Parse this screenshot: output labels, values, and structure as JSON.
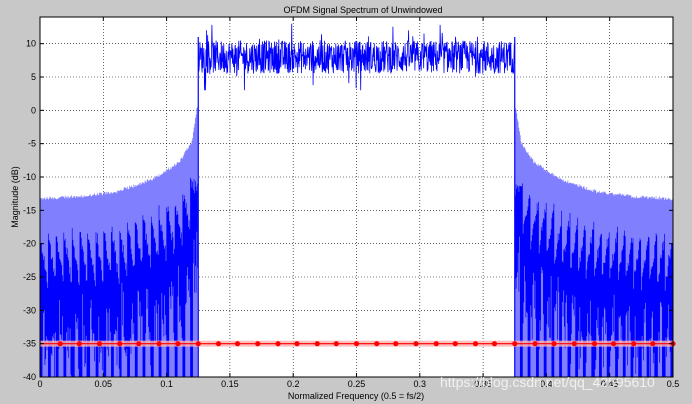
{
  "chart_data": {
    "type": "line",
    "title": "OFDM Signal Spectrum of Unwindowed",
    "xlabel": "Normalized Frequency (0.5 = fs/2)",
    "ylabel": "Magnitude (dB)",
    "xlim": [
      0,
      0.5
    ],
    "ylim": [
      -40,
      14
    ],
    "xticks": [
      0,
      0.05,
      0.1,
      0.15,
      0.2,
      0.25,
      0.3,
      0.35,
      0.4,
      0.45,
      0.5
    ],
    "xtick_labels": [
      "0",
      "0.05",
      "0.1",
      "0.15",
      "0.2",
      "0.25",
      "0.3",
      "0.35",
      "0.4",
      "0.45",
      "0.5"
    ],
    "yticks": [
      -40,
      -35,
      -30,
      -25,
      -20,
      -15,
      -10,
      -5,
      0,
      5,
      10
    ],
    "ytick_labels": [
      "-40",
      "-35",
      "-30",
      "-25",
      "-20",
      "-15",
      "-10",
      "-5",
      "0",
      "5",
      "10"
    ],
    "grid": true,
    "colors": {
      "spectrum": "#0000ff",
      "marker_line": "#ff0000",
      "axes_bg": "#ffffff",
      "figure_bg": "#c8c8c8"
    },
    "series": [
      {
        "style": "noisy-spectrum",
        "passband": {
          "x": [
            0.125,
            0.375
          ],
          "mean_db": 8,
          "min_db": 3,
          "max_db": 13
        },
        "sidelobe_envelope": {
          "x": [
            0,
            0.03,
            0.06,
            0.09,
            0.11,
            0.12,
            0.124
          ],
          "y": [
            -13.5,
            -13.2,
            -12.5,
            -10.5,
            -8,
            -5,
            0
          ]
        },
        "sidelobe_floor_db": -40
      },
      {
        "style": "marker-line",
        "y": -35,
        "marker_x": [
          0.016,
          0.031,
          0.047,
          0.063,
          0.078,
          0.094,
          0.109,
          0.125,
          0.141,
          0.156,
          0.172,
          0.188,
          0.203,
          0.219,
          0.234,
          0.25,
          0.266,
          0.281,
          0.297,
          0.313,
          0.328,
          0.344,
          0.359,
          0.375,
          0.391,
          0.406,
          0.422,
          0.438,
          0.453,
          0.469,
          0.484,
          0.5
        ]
      }
    ]
  },
  "watermark": "https://blog.csdn.net/qq_42595610"
}
